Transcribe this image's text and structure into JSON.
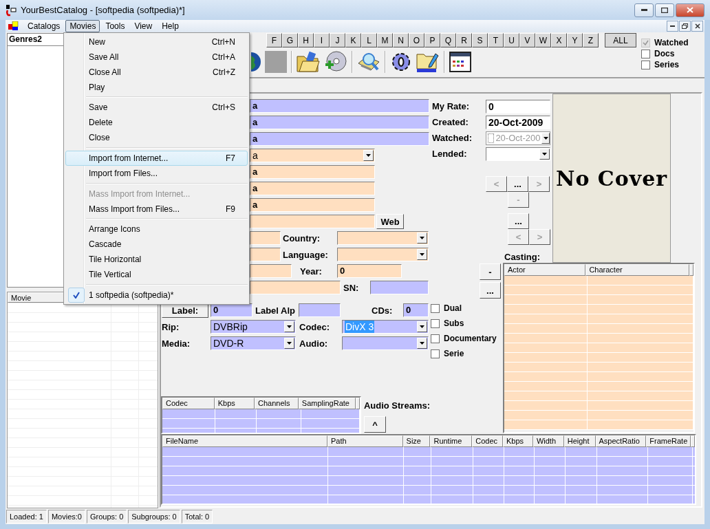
{
  "window": {
    "title": "YourBestCatalog - [softpedia (softpedia)*]"
  },
  "menu_bar": [
    {
      "label": "Catalogs",
      "selected": false
    },
    {
      "label": "Movies",
      "selected": true
    },
    {
      "label": "Tools",
      "selected": false
    },
    {
      "label": "View",
      "selected": false
    },
    {
      "label": "Help",
      "selected": false
    }
  ],
  "movies_menu": [
    {
      "kind": "item",
      "label": "New",
      "shortcut": "Ctrl+N",
      "selected": false,
      "disabled": false,
      "checked": false
    },
    {
      "kind": "item",
      "label": "Save All",
      "shortcut": "Ctrl+A",
      "selected": false,
      "disabled": false,
      "checked": false
    },
    {
      "kind": "item",
      "label": "Close All",
      "shortcut": "Ctrl+Z",
      "selected": false,
      "disabled": false,
      "checked": false
    },
    {
      "kind": "item",
      "label": "Play",
      "selected": false,
      "disabled": false,
      "checked": false
    },
    {
      "kind": "separator"
    },
    {
      "kind": "item",
      "label": "Save",
      "shortcut": "Ctrl+S",
      "selected": false,
      "disabled": false,
      "checked": false
    },
    {
      "kind": "item",
      "label": "Delete",
      "selected": false,
      "disabled": false,
      "checked": false
    },
    {
      "kind": "item",
      "label": "Close",
      "selected": false,
      "disabled": false,
      "checked": false
    },
    {
      "kind": "separator"
    },
    {
      "kind": "item",
      "label": "Import from Internet...",
      "shortcut": "F7",
      "selected": true,
      "disabled": false,
      "checked": false
    },
    {
      "kind": "item",
      "label": "Import from Files...",
      "selected": false,
      "disabled": false,
      "checked": false
    },
    {
      "kind": "separator"
    },
    {
      "kind": "item",
      "label": "Mass Import from Internet...",
      "selected": false,
      "disabled": true,
      "checked": false
    },
    {
      "kind": "item",
      "label": "Mass Import from Files...",
      "shortcut": "F9",
      "selected": false,
      "disabled": false,
      "checked": false
    },
    {
      "kind": "separator"
    },
    {
      "kind": "item",
      "label": "Arrange Icons",
      "selected": false,
      "disabled": false,
      "checked": false
    },
    {
      "kind": "item",
      "label": "Cascade",
      "selected": false,
      "disabled": false,
      "checked": false
    },
    {
      "kind": "item",
      "label": "Tile Horizontal",
      "selected": false,
      "disabled": false,
      "checked": false
    },
    {
      "kind": "item",
      "label": "Tile Vertical",
      "selected": false,
      "disabled": false,
      "checked": false
    },
    {
      "kind": "separator"
    },
    {
      "kind": "item",
      "label": "1 softpedia (softpedia)*",
      "selected": false,
      "disabled": false,
      "checked": true
    }
  ],
  "letter_buttons": [
    "F",
    "G",
    "H",
    "I",
    "J",
    "K",
    "L",
    "M",
    "N",
    "O",
    "P",
    "Q",
    "R",
    "S",
    "T",
    "U",
    "V",
    "W",
    "X",
    "Y",
    "Z"
  ],
  "all_button": "ALL",
  "filters": [
    {
      "label": "Watched",
      "checked": true,
      "disabled": true
    },
    {
      "label": "Docs",
      "checked": false,
      "disabled": false
    },
    {
      "label": "Series",
      "checked": false,
      "disabled": false
    }
  ],
  "left_panel": {
    "tree_header": "Genres2",
    "list_columns": [
      "Movie"
    ]
  },
  "form": {
    "rows": [
      [
        {
          "kind": "field",
          "value": "a",
          "color": "#c0c0ff"
        }
      ],
      [
        {
          "kind": "field",
          "value": "a",
          "color": "#c0c0ff"
        }
      ],
      [
        {
          "kind": "field",
          "value": "a",
          "color": "#c0c0ff"
        }
      ],
      [
        {
          "kind": "combo",
          "value": "a",
          "color": "#ffdfc0"
        }
      ],
      [
        {
          "kind": "field",
          "value": "a",
          "color": "#ffdfc0"
        }
      ],
      [
        {
          "kind": "field",
          "value": "a",
          "color": "#ffdfc0"
        }
      ],
      [
        {
          "kind": "field",
          "value": "a",
          "color": "#ffdfc0"
        }
      ],
      [
        {
          "kind": "field",
          "color": "#ffdfc0"
        },
        {
          "kind": "button",
          "label": "Web"
        }
      ],
      [
        {
          "kind": "field",
          "color": "#ffdfc0"
        },
        {
          "kind": "label",
          "label": "Country:"
        },
        {
          "kind": "combo",
          "color": "#ffdfc0"
        }
      ],
      [
        {
          "kind": "field",
          "color": "#ffdfc0"
        },
        {
          "kind": "label",
          "label": "Language:"
        },
        {
          "kind": "combo",
          "color": "#ffdfc0"
        }
      ],
      [
        {
          "kind": "field",
          "color": "#ffdfc0"
        },
        {
          "kind": "label",
          "label": "Year:"
        },
        {
          "kind": "field",
          "value": "0",
          "color": "#ffdfc0"
        }
      ],
      [
        {
          "kind": "field",
          "color": "#ffdfc0"
        },
        {
          "kind": "label",
          "label": "SN:"
        },
        {
          "kind": "field",
          "color": "#c0c0ff"
        }
      ]
    ],
    "label_row": [
      {
        "kind": "button",
        "label": "Label:"
      },
      {
        "kind": "field",
        "value": "0",
        "color": "#c0c0ff"
      },
      {
        "kind": "label",
        "label": "Label Alp"
      },
      {
        "kind": "field",
        "color": "#c0c0ff"
      },
      {
        "kind": "label",
        "label": "CDs:"
      },
      {
        "kind": "field",
        "value": "0",
        "color": "#c0c0ff"
      }
    ],
    "media_rows": [
      [
        {
          "kind": "label",
          "label": "Rip:"
        },
        {
          "kind": "combo",
          "value": "DVBRip",
          "color": "#c0c0ff",
          "selected": false
        },
        {
          "kind": "label",
          "label": "Codec:"
        },
        {
          "kind": "combo",
          "value": "DivX 3",
          "color": "#c0c0ff",
          "selected": true
        }
      ],
      [
        {
          "kind": "label",
          "label": "Media:"
        },
        {
          "kind": "combo",
          "value": "DVD-R",
          "color": "#c0c0ff",
          "selected": false
        },
        {
          "kind": "label",
          "label": "Audio:"
        },
        {
          "kind": "combo",
          "color": "#c0c0ff"
        }
      ]
    ],
    "info_fields": [
      {
        "kind": "field",
        "label": "My Rate:",
        "value": "0"
      },
      {
        "kind": "field",
        "label": "Created:",
        "value": "20-Oct-2009"
      },
      {
        "kind": "date",
        "label": "Watched:",
        "value": "20-Oct-200",
        "checked": false
      },
      {
        "kind": "combo",
        "label": "Lended:"
      }
    ],
    "cover_nav": [
      {
        "label": "<",
        "disabled": true
      },
      {
        "label": "...",
        "disabled": false
      },
      {
        "label": ">",
        "disabled": true
      }
    ],
    "cover_remove": {
      "label": "-",
      "disabled": true
    },
    "cover_browse": {
      "label": "...",
      "disabled": false
    },
    "cover_nav_2": [
      {
        "label": "<",
        "disabled": true
      },
      {
        "label": ">",
        "disabled": true
      }
    ],
    "cover": {
      "text": "No Cover"
    },
    "casting": {
      "label": "Casting:",
      "buttons": [
        "-",
        "..."
      ],
      "columns": [
        "Actor",
        "Character"
      ]
    },
    "options": [
      {
        "label": "Dual",
        "checked": false
      },
      {
        "label": "Subs",
        "checked": false
      },
      {
        "label": "Documentary",
        "checked": false
      },
      {
        "label": "Serie",
        "checked": false
      }
    ],
    "audio_streams": {
      "columns": [
        "Codec",
        "Kbps",
        "Channels",
        "SamplingRate"
      ],
      "label": "Audio Streams:",
      "button": "^"
    },
    "files": {
      "columns": [
        "FileName",
        "Path",
        "Size",
        "Runtime",
        "Codec",
        "Kbps",
        "Width",
        "Height",
        "AspectRatio",
        "FrameRate"
      ]
    }
  },
  "status_bar": [
    "Loaded: 1",
    "Movies:0",
    "Groups: 0",
    "Subgroups: 0",
    "Total: 0"
  ]
}
